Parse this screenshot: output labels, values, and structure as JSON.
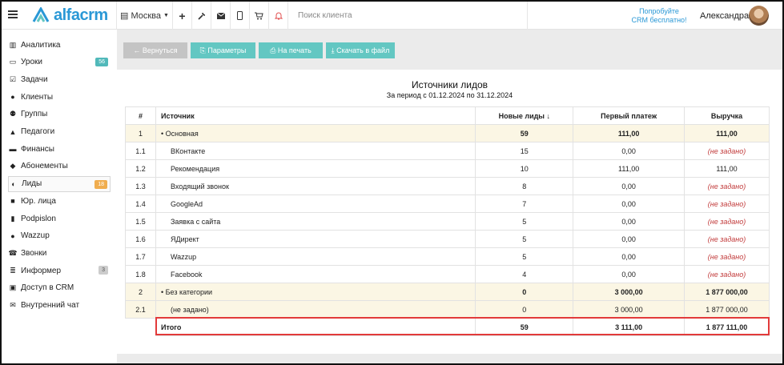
{
  "app": {
    "logo_text": "alfacrm",
    "city": "Москва",
    "search_placeholder": "Поиск клиента",
    "promo_line1": "Попробуйте",
    "promo_line2": "CRM бесплатно!",
    "user_name": "Александра",
    "colors": {
      "brand": "#2a98d6",
      "teal": "#63c7c2",
      "alert": "#e14c4c",
      "highlight": "#e23a3a"
    }
  },
  "sidebar": {
    "items": [
      {
        "label": "Аналитика",
        "icon": "analytics-icon",
        "glyph": "▥"
      },
      {
        "label": "Уроки",
        "icon": "calendar-icon",
        "glyph": "▭",
        "badge": "56",
        "badge_color": "teal"
      },
      {
        "label": "Задачи",
        "icon": "tasks-icon",
        "glyph": "☑"
      },
      {
        "label": "Клиенты",
        "icon": "user-icon",
        "glyph": "●"
      },
      {
        "label": "Группы",
        "icon": "group-icon",
        "glyph": "⚉"
      },
      {
        "label": "Педагоги",
        "icon": "teacher-icon",
        "glyph": "▲"
      },
      {
        "label": "Финансы",
        "icon": "money-icon",
        "glyph": "▬"
      },
      {
        "label": "Абонементы",
        "icon": "tag-icon",
        "glyph": "◆"
      },
      {
        "label": "Лиды",
        "icon": "lead-icon",
        "glyph": "◐",
        "badge": "18",
        "badge_color": "orange",
        "active": true
      },
      {
        "label": "Юр. лица",
        "icon": "briefcase-icon",
        "glyph": "■"
      },
      {
        "label": "Podpislon",
        "icon": "document-icon",
        "glyph": "▮"
      },
      {
        "label": "Wazzup",
        "icon": "chat-bubble-icon",
        "glyph": "●"
      },
      {
        "label": "Звонки",
        "icon": "phone-icon",
        "glyph": "☎"
      },
      {
        "label": "Информер",
        "icon": "list-icon",
        "glyph": "≣",
        "badge": "3",
        "badge_color": "grey"
      },
      {
        "label": "Доступ в CRM",
        "icon": "lock-icon",
        "glyph": "▣"
      },
      {
        "label": "Внутренний чат",
        "icon": "envelope-icon",
        "glyph": "✉"
      }
    ]
  },
  "toolbar": {
    "back_label": "← Вернуться",
    "params_label": "⎘ Параметры",
    "print_label": "⎙ На печать",
    "download_label": "⤓ Скачать в файл"
  },
  "report": {
    "title": "Источники лидов",
    "subtitle": "За период с 01.12.2024 по 31.12.2024",
    "headers": {
      "num": "#",
      "source": "Источник",
      "new_leads": "Новые лиды ↓",
      "first_payment": "Первый платеж",
      "revenue": "Выручка"
    },
    "rows": [
      {
        "num": "1",
        "source": "Основная",
        "new_leads": "59",
        "first_payment": "111,00",
        "revenue": "111,00",
        "group": true
      },
      {
        "num": "1.1",
        "source": "ВКонтакте",
        "new_leads": "15",
        "first_payment": "0,00",
        "revenue": "(не задано)",
        "revenue_notset": true
      },
      {
        "num": "1.2",
        "source": "Рекомендация",
        "new_leads": "10",
        "first_payment": "111,00",
        "revenue": "111,00"
      },
      {
        "num": "1.3",
        "source": "Входящий звонок",
        "new_leads": "8",
        "first_payment": "0,00",
        "revenue": "(не задано)",
        "revenue_notset": true
      },
      {
        "num": "1.4",
        "source": "GoogleAd",
        "new_leads": "7",
        "first_payment": "0,00",
        "revenue": "(не задано)",
        "revenue_notset": true
      },
      {
        "num": "1.5",
        "source": "Заявка с сайта",
        "new_leads": "5",
        "first_payment": "0,00",
        "revenue": "(не задано)",
        "revenue_notset": true
      },
      {
        "num": "1.6",
        "source": "ЯДирект",
        "new_leads": "5",
        "first_payment": "0,00",
        "revenue": "(не задано)",
        "revenue_notset": true
      },
      {
        "num": "1.7",
        "source": "Wazzup",
        "new_leads": "5",
        "first_payment": "0,00",
        "revenue": "(не задано)",
        "revenue_notset": true
      },
      {
        "num": "1.8",
        "source": "Facebook",
        "new_leads": "4",
        "first_payment": "0,00",
        "revenue": "(не задано)",
        "revenue_notset": true
      },
      {
        "num": "2",
        "source": "Без категории",
        "new_leads": "0",
        "first_payment": "3 000,00",
        "revenue": "1 877 000,00",
        "group": true
      },
      {
        "num": "2.1",
        "source": "(не задано)",
        "new_leads": "0",
        "first_payment": "3 000,00",
        "revenue": "1 877 000,00",
        "tinted": true
      }
    ],
    "total": {
      "label": "Итого",
      "new_leads": "59",
      "first_payment": "3 111,00",
      "revenue": "1 877 111,00"
    }
  }
}
